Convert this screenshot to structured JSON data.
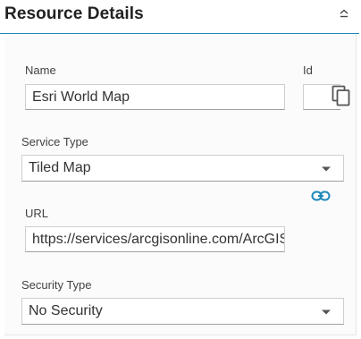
{
  "header": {
    "title": "Resource Details",
    "collapse_icon": "chevron-up-icon"
  },
  "form": {
    "name_label": "Name",
    "name_value": "Esri World Map",
    "id_label": "Id",
    "id_value": "",
    "copy_icon": "copy-icon",
    "service_type_label": "Service Type",
    "service_type_value": "Tiled Map",
    "link_icon": "link-icon",
    "url_label": "URL",
    "url_value": "https://services/arcgisonline.com/ArcGIS",
    "security_type_label": "Security Type",
    "security_type_value": "No Security"
  },
  "colors": {
    "accent": "#1e88b9",
    "header_divider": "#1e88b9"
  }
}
